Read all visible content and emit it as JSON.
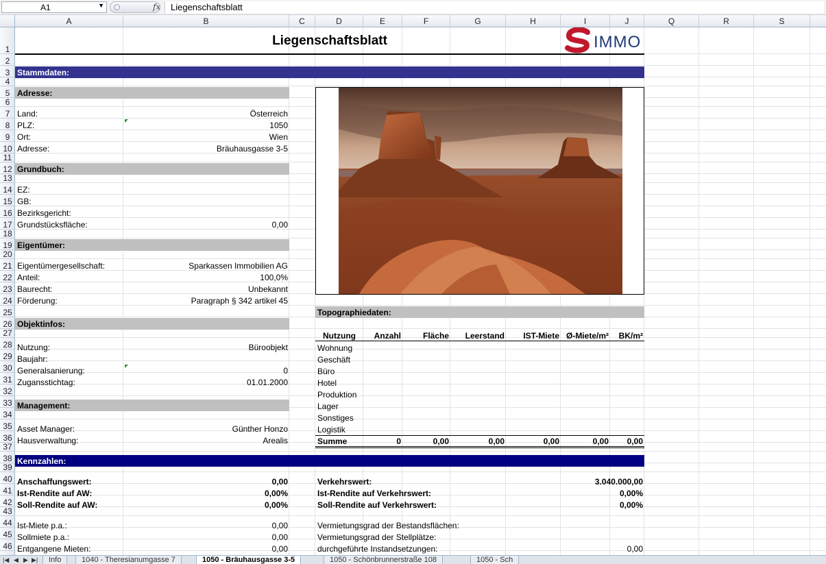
{
  "formula_bar": {
    "cell_ref": "A1",
    "fx_label": "fx",
    "value": "Liegenschaftsblatt"
  },
  "columns": [
    "A",
    "B",
    "C",
    "D",
    "E",
    "F",
    "G",
    "H",
    "I",
    "J",
    "Q",
    "R",
    "S"
  ],
  "rows": [
    "1",
    "2",
    "3",
    "4",
    "5",
    "6",
    "7",
    "8",
    "9",
    "10",
    "11",
    "12",
    "13",
    "14",
    "15",
    "16",
    "17",
    "18",
    "19",
    "20",
    "21",
    "22",
    "23",
    "24",
    "25",
    "26",
    "27",
    "28",
    "29",
    "30",
    "31",
    "32",
    "33",
    "34",
    "35",
    "36",
    "37",
    "38",
    "39",
    "40",
    "41",
    "42",
    "43",
    "44",
    "45",
    "46"
  ],
  "title": "Liegenschaftsblatt",
  "logo": {
    "letter": "S",
    "text": "IMMO",
    "accent": "#c0192c",
    "text_color": "#1e3a78"
  },
  "colors": {
    "section_bar": "#33338f",
    "kennzahlen_bar": "#000080",
    "subheader_bar": "#c0c0c0"
  },
  "stammdaten": "Stammdaten:",
  "adresse": {
    "header": "Adresse:",
    "land_label": "Land:",
    "land": "Österreich",
    "plz_label": "PLZ:",
    "plz": "1050",
    "ort_label": "Ort:",
    "ort": "Wien",
    "adresse_label": "Adresse:",
    "adresse": "Bräuhausgasse 3-5"
  },
  "grundbuch": {
    "header": "Grundbuch:",
    "ez_label": "EZ:",
    "gb_label": "GB:",
    "bezirksgericht_label": "Bezirksgericht:",
    "flaeche_label": "Grundstücksfläche:",
    "flaeche": "0,00"
  },
  "eigentuemer": {
    "header": "Eigentümer:",
    "ges_label": "Eigentümergesellschaft:",
    "ges": "Sparkassen Immobilien AG",
    "anteil_label": "Anteil:",
    "anteil": "100,0%",
    "baurecht_label": "Baurecht:",
    "baurecht": "Unbekannt",
    "foerderung_label": "Förderung:",
    "foerderung": "Paragraph § 342 artikel 45"
  },
  "objektinfos": {
    "header": "Objektinfos:",
    "nutzung_label": "Nutzung:",
    "nutzung": "Büroobjekt",
    "baujahr_label": "Baujahr:",
    "general_label": "Generalsanierung:",
    "general": "0",
    "zugang_label": "Zugansstichtag:",
    "zugang": "01.01.2000"
  },
  "management": {
    "header": "Management:",
    "am_label": "Asset Manager:",
    "am": "Günther Honzo",
    "hv_label": "Hausverwaltung:",
    "hv": "Arealis"
  },
  "topo": {
    "header": "Topographiedaten:",
    "columns": [
      "Nutzung",
      "Anzahl",
      "Fläche",
      "Leerstand",
      "IST-Miete",
      "Ø-Miete/m²",
      "BK/m²"
    ],
    "rows": [
      "Wohnung",
      "Geschäft",
      "Büro",
      "Hotel",
      "Produktion",
      "Lager",
      "Sonstiges",
      "Logistik"
    ],
    "summe_label": "Summe",
    "summe": [
      "0",
      "0,00",
      "0,00",
      "0,00",
      "0,00",
      "0,00"
    ]
  },
  "kennzahlen": {
    "header": "Kennzahlen:",
    "aw_label": "Anschaffungswert:",
    "aw": "0,00",
    "ist_aw_label": "Ist-Rendite auf AW:",
    "ist_aw": "0,00%",
    "soll_aw_label": "Soll-Rendite auf AW:",
    "soll_aw": "0,00%",
    "vw_label": "Verkehrswert:",
    "vw": "3.040.000,00",
    "ist_vw_label": "Ist-Rendite auf Verkehrswert:",
    "ist_vw": "0,00%",
    "soll_vw_label": "Soll-Rendite auf Verkehrswert:",
    "soll_vw": "0,00%",
    "ist_miete_label": "Ist-Miete p.a.:",
    "ist_miete": "0,00",
    "soll_miete_label": "Sollmiete p.a.:",
    "soll_miete": "0,00",
    "entg_label": "Entgangene Mieten:",
    "entg": "0,00",
    "verm_best_label": "Vermietungsgrad der Bestandsflächen:",
    "verm_stell_label": "Vermietungsgrad der Stellplätze:",
    "instand_label": "durchgeführte Instandsetzungen:",
    "instand": "0,00"
  },
  "tabs": [
    "Info",
    "1040 - Theresianumgasse 7",
    "1050 - Bräuhausgasse 3-5",
    "1050 - Schönbrunnerstraße 108",
    "1050 - Sch"
  ],
  "active_tab": "1050 - Bräuhausgasse 3-5"
}
